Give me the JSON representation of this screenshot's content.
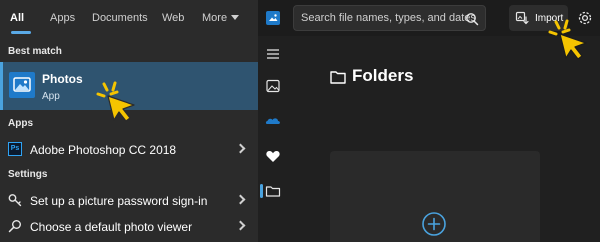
{
  "search_panel": {
    "tabs": [
      {
        "label": "All",
        "active": true
      },
      {
        "label": "Apps",
        "active": false
      },
      {
        "label": "Documents",
        "active": false
      },
      {
        "label": "Web",
        "active": false
      },
      {
        "label": "More",
        "active": false
      }
    ],
    "best_match": {
      "heading": "Best match",
      "title": "Photos",
      "subtitle": "App",
      "icon": "photos-app-icon"
    },
    "apps": {
      "heading": "Apps",
      "items": [
        {
          "label": "Adobe Photoshop CC 2018",
          "icon": "photoshop-icon",
          "icon_text": "Ps"
        }
      ]
    },
    "settings": {
      "heading": "Settings",
      "items": [
        {
          "label": "Set up a picture password sign-in",
          "icon": "key-icon"
        },
        {
          "label": "Choose a default photo viewer",
          "icon": "search-icon"
        }
      ]
    }
  },
  "photos_app": {
    "search_placeholder": "Search file names, types, and dates",
    "import_label": "Import",
    "section_title": "Folders",
    "nav": [
      "menu-icon",
      "gallery-icon",
      "onedrive-icon",
      "favorites-icon",
      "folders-icon"
    ],
    "active_nav": "folders-icon"
  },
  "colors": {
    "accent": "#4aa3df",
    "highlight_bg": "#2f5470",
    "cursor": "#f5c400"
  }
}
